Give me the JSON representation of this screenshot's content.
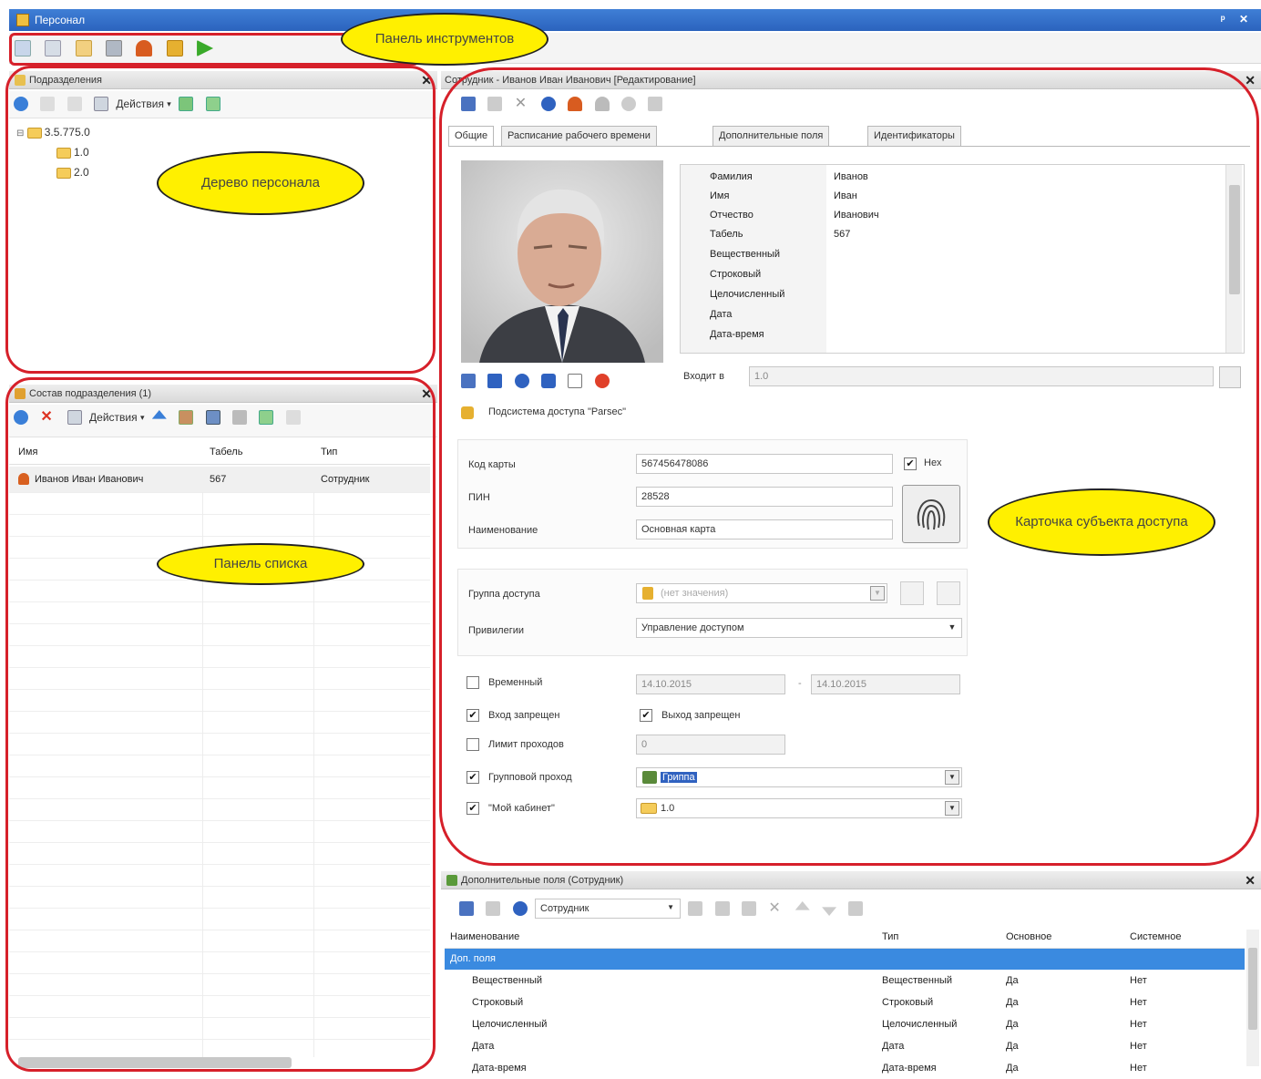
{
  "window": {
    "title": "Персонал",
    "controls": "ᵖ ✕"
  },
  "callouts": {
    "toolbar": "Панель инструментов",
    "tree": "Дерево персонала",
    "list": "Панель списка",
    "card": "Карточка субъекта доступа"
  },
  "departments_panel": {
    "title": "Подразделения",
    "actions_label": "Действия",
    "tree": [
      {
        "label": "3.5.775.0"
      },
      {
        "label": "1.0"
      },
      {
        "label": "2.0"
      }
    ]
  },
  "list_panel": {
    "title": "Состав подразделения (1)",
    "actions_label": "Действия",
    "columns": [
      "Имя",
      "Табель",
      "Тип"
    ],
    "rows": [
      {
        "name": "Иванов Иван Иванович",
        "tabel": "567",
        "type": "Сотрудник"
      }
    ]
  },
  "card_panel": {
    "title": "Сотрудник - Иванов Иван Иванович [Редактирование]",
    "tabs": [
      "Общие",
      "Расписание рабочего времени",
      "Дополнительные поля",
      "Идентификаторы"
    ],
    "props": [
      {
        "k": "Фамилия",
        "v": "Иванов"
      },
      {
        "k": "Имя",
        "v": "Иван"
      },
      {
        "k": "Отчество",
        "v": "Иванович"
      },
      {
        "k": "Табель",
        "v": "567"
      },
      {
        "k": "Вещественный",
        "v": ""
      },
      {
        "k": "Строковый",
        "v": ""
      },
      {
        "k": "Целочисленный",
        "v": ""
      },
      {
        "k": "Дата",
        "v": ""
      },
      {
        "k": "Дата-время",
        "v": ""
      }
    ],
    "belongs_label": "Входит в",
    "belongs_value": "1.0",
    "subsystem": "Подсистема доступа \"Parsec\"",
    "card_code_label": "Код карты",
    "card_code": "567456478086",
    "hex_label": "Hex",
    "pin_label": "ПИН",
    "pin": "28528",
    "name_label": "Наименование",
    "name_value": "Основная карта",
    "access_group_label": "Группа доступа",
    "access_group_value": "(нет значения)",
    "privileges_label": "Привилегии",
    "privileges_value": "Управление доступом",
    "temporary_label": "Временный",
    "date_from": "14.10.2015",
    "date_to": "14.10.2015",
    "entry_denied_label": "Вход запрещен",
    "exit_denied_label": "Выход запрещен",
    "pass_limit_label": "Лимит проходов",
    "pass_limit_value": "0",
    "group_pass_label": "Групповой проход",
    "group_pass_value": "Гриппа",
    "my_office_label": "\"Мой кабинет\"",
    "my_office_value": "1.0"
  },
  "extra_panel": {
    "title": "Дополнительные поля (Сотрудник)",
    "filter_value": "Сотрудник",
    "columns": [
      "Наименование",
      "Тип",
      "Основное",
      "Системное"
    ],
    "group_row": "Доп. поля",
    "rows": [
      {
        "name": "Вещественный",
        "type": "Вещественный",
        "main": "Да",
        "sys": "Нет"
      },
      {
        "name": "Строковый",
        "type": "Строковый",
        "main": "Да",
        "sys": "Нет"
      },
      {
        "name": "Целочисленный",
        "type": "Целочисленный",
        "main": "Да",
        "sys": "Нет"
      },
      {
        "name": "Дата",
        "type": "Дата",
        "main": "Да",
        "sys": "Нет"
      },
      {
        "name": "Дата-время",
        "type": "Дата-время",
        "main": "Да",
        "sys": "Нет"
      }
    ]
  }
}
